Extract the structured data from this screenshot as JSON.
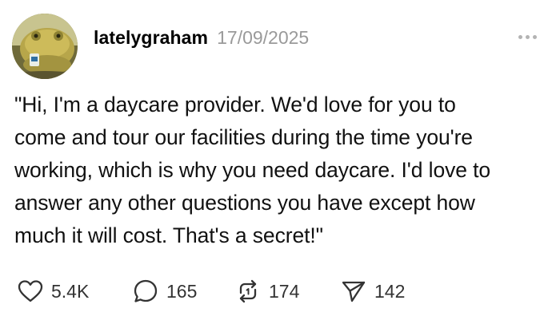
{
  "post": {
    "author": {
      "username": "latelygraham",
      "avatar_icon": "frog-avatar-icon"
    },
    "timestamp": "17/09/2025",
    "more_icon": "more-dots-icon",
    "text_lines": [
      "\"Hi, I'm a daycare provider. We'd love for you to",
      "come and tour our facilities during the time you're",
      "working, which is why you need daycare. I'd love to",
      "answer any other questions you have except how",
      "much it will cost. That's a secret!\""
    ],
    "actions": {
      "like": {
        "icon": "heart-icon",
        "count": "5.4K"
      },
      "comment": {
        "icon": "comment-bubble-icon",
        "count": "165"
      },
      "repost": {
        "icon": "repost-icon",
        "count": "174"
      },
      "share": {
        "icon": "send-icon",
        "count": "142"
      }
    }
  },
  "colors": {
    "username": "#000000",
    "timestamp": "#9a9a9a",
    "body_text": "#111111",
    "icon_stroke": "#333333",
    "more_dots": "#b3b3b3"
  }
}
